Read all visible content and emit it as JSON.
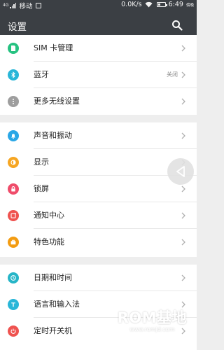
{
  "status_bar": {
    "network_type": "4G",
    "carrier": "移动",
    "speed": "0.0K/s",
    "time": "6:49",
    "time_suffix": "傍晚"
  },
  "app_bar": {
    "title": "设置",
    "search_icon": "search-icon"
  },
  "sections": [
    {
      "items": [
        {
          "label": "SIM 卡管理",
          "icon": "sim-card-icon",
          "color": "#26c281"
        },
        {
          "label": "蓝牙",
          "icon": "bluetooth-icon",
          "color": "#29b6d8",
          "value": "关闭"
        },
        {
          "label": "更多无线设置",
          "icon": "more-dots-icon",
          "color": "#9e9e9e"
        }
      ]
    },
    {
      "items": [
        {
          "label": "声音和振动",
          "icon": "bell-icon",
          "color": "#2aa7e6"
        },
        {
          "label": "显示",
          "icon": "display-icon",
          "color": "#f6a623"
        },
        {
          "label": "锁屏",
          "icon": "lock-icon",
          "color": "#ef4c6a"
        },
        {
          "label": "通知中心",
          "icon": "notification-icon",
          "color": "#ef5350"
        },
        {
          "label": "特色功能",
          "icon": "briefcase-icon",
          "color": "#f39c12"
        }
      ]
    },
    {
      "items": [
        {
          "label": "日期和时间",
          "icon": "clock-icon",
          "color": "#26b5c7"
        },
        {
          "label": "语言和输入法",
          "icon": "text-t-icon",
          "color": "#29b6d8"
        },
        {
          "label": "定时开关机",
          "icon": "power-timer-icon",
          "color": "#ef5350"
        }
      ]
    }
  ],
  "floating_button": {
    "icon": "back-triangle-icon"
  },
  "watermark": {
    "title": "ROM基地",
    "url": "www.romjd.com"
  }
}
